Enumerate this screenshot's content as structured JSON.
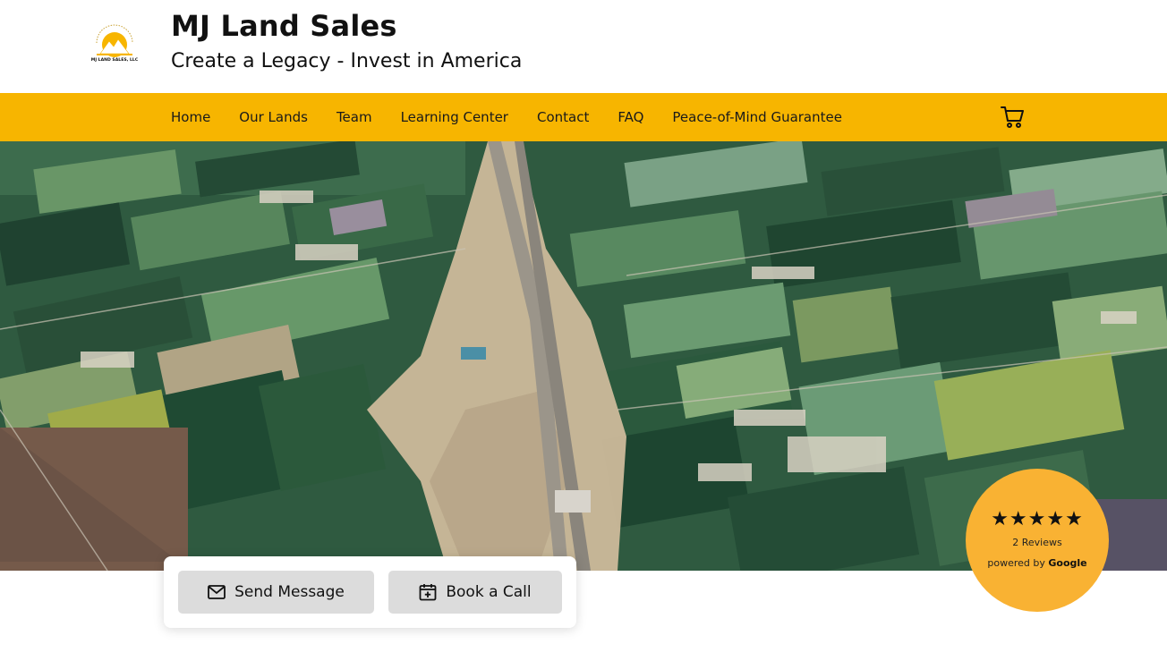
{
  "header": {
    "title": "MJ Land Sales",
    "tagline": "Create a Legacy - Invest in America",
    "logo_text": "MJ LAND SALES, LLC"
  },
  "nav": {
    "items": [
      {
        "label": "Home"
      },
      {
        "label": "Our Lands"
      },
      {
        "label": "Team"
      },
      {
        "label": "Learning Center"
      },
      {
        "label": "Contact"
      },
      {
        "label": "FAQ"
      },
      {
        "label": "Peace-of-Mind Guarantee"
      }
    ],
    "cart_icon": "cart-icon"
  },
  "actions": {
    "send_label": "Send Message",
    "send_icon": "mail-icon",
    "book_label": "Book a Call",
    "book_icon": "calendar-plus-icon"
  },
  "reviews": {
    "stars": "★★★★★",
    "rating": 5,
    "count_label": "2 Reviews",
    "powered_prefix": "powered by",
    "powered_brand": "Google"
  },
  "colors": {
    "nav_bg": "#f7b500",
    "badge_bg": "#f9b233",
    "button_bg": "#dcdcdc"
  }
}
